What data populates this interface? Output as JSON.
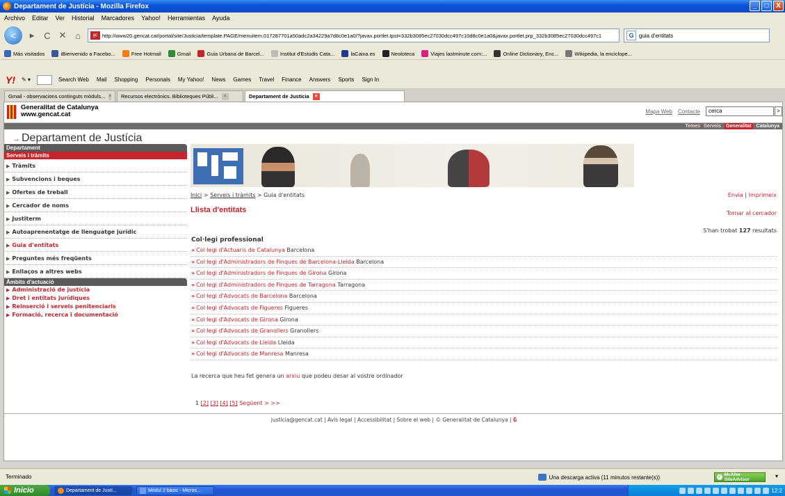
{
  "window": {
    "title": "Departament de Justícia - Mozilla Firefox",
    "min": "_",
    "max": "□",
    "close": "X"
  },
  "menu": [
    "Archivo",
    "Editar",
    "Ver",
    "Historial",
    "Marcadores",
    "Yahoo!",
    "Herramientas",
    "Ayuda"
  ],
  "nav": {
    "back": "<",
    "forward": "▸",
    "reload": "C",
    "stop": "✕",
    "home": "⌂",
    "url": "http://www20.gencat.cat/portal/site/Justicia/template.PAGE/menuitem.017287701a50adc2a34229a7d8c0e1a0/?javax.portlet.tpst=332b3085ec27030dcc497c10d8c0e1a0&javax.portlet.prp_332b3085ec27030dcc497c1",
    "search_value": "guia d'entitats"
  },
  "bookmarks": [
    {
      "label": "Más visitados",
      "color": "#3a66b8"
    },
    {
      "label": "iBienvenido a Facebo...",
      "color": "#3b5998"
    },
    {
      "label": "Free Hotmail",
      "color": "#f07d1a"
    },
    {
      "label": "Gmail",
      "color": "#2e8b3a"
    },
    {
      "label": "Guia Urbana de Barcel...",
      "color": "#c4242c"
    },
    {
      "label": "Institut d'Estudis Cata...",
      "color": "#bbbbbb"
    },
    {
      "label": "laCaixa.es",
      "color": "#1b3b8c"
    },
    {
      "label": "Neoloteca",
      "color": "#222222"
    },
    {
      "label": "Viajes lastminute.com:...",
      "color": "#d6207e"
    },
    {
      "label": "Online Dictionary, Enc...",
      "color": "#333333"
    },
    {
      "label": "Wikipedia, la enciclope...",
      "color": "#777777"
    }
  ],
  "yahoo_toolbar": {
    "logo": "Y!",
    "items": [
      "Search Web",
      "Mail",
      "Shopping",
      "Personals",
      "My Yahoo!",
      "News",
      "Games",
      "Travel",
      "Finance",
      "Answers",
      "Sports",
      "Sign In"
    ]
  },
  "tabs": [
    {
      "label": "Gmail - observacions continguts mòduls...",
      "active": false
    },
    {
      "label": "Recursos electrònics. Biblioteques Públi...",
      "active": false
    },
    {
      "label": "Departament de Justícia",
      "active": true
    }
  ],
  "site": {
    "org_name": "Generalitat de Catalunya",
    "org_url": "www.gencat.cat",
    "top_links": [
      "Mapa Web",
      "Contacte"
    ],
    "search_value": "cerca",
    "search_go": ">",
    "category_nav": [
      "Temes",
      "Serveis",
      "Generalitat",
      "Catalunya"
    ],
    "category_active": "Generalitat",
    "dept_title": "Departament de Justícia",
    "dept_arrow": "→"
  },
  "sidebar": {
    "heading1": "Departament",
    "heading2": "Serveis i tràmits",
    "items": [
      "Tràmits",
      "Subvencions i beques",
      "Ofertes de treball",
      "Cercador de noms",
      "Justiterm",
      "Autoaprenentatge de llenguatge jurídic",
      "Guia d'entitats",
      "Preguntes més freqüents",
      "Enllaços a altres webs"
    ],
    "active_item": "Guia d'entitats",
    "heading3": "Àmbits d'actuació",
    "ambits": [
      "Administració de justícia",
      "Dret i entitats jurídiques",
      "Reinserció i serveis penitenciaris",
      "Formació, recerca i documentació"
    ]
  },
  "breadcrumb": {
    "home": "Inici",
    "sep1": " > ",
    "section": "Serveis i tràmits",
    "sep2": " > ",
    "current": "Guia d'entitats"
  },
  "page_tools": {
    "send": "Envia",
    "sep": " | ",
    "print": "Imprimeix"
  },
  "main": {
    "title": "Llista d'entitats",
    "back_search": "Tornar al cercador",
    "results_prefix": "S'han trobat ",
    "results_count": "127",
    "results_suffix": " resultats",
    "section": "Col·legi professional",
    "entities": [
      {
        "name": "Col·legi d'Actuaris de Catalunya",
        "city": "Barcelona"
      },
      {
        "name": "Col·legi d'Administradors de Finques de Barcelona-Lleida",
        "city": "Barcelona"
      },
      {
        "name": "Col·legi d'Administradors de Finques de Girona",
        "city": "Girona"
      },
      {
        "name": "Col·legi d'Administradors de Finques de Tarragona",
        "city": "Tarragona"
      },
      {
        "name": "Col·legi d'Advocats de Barcelona",
        "city": "Barcelona"
      },
      {
        "name": "Col·legi d'Advocats de Figueres",
        "city": "Figueres"
      },
      {
        "name": "Col·legi d'Advocats de Girona",
        "city": "Girona"
      },
      {
        "name": "Col·legi d'Advocats de Granollers",
        "city": "Granollers"
      },
      {
        "name": "Col·legi d'Advocats de Lleida",
        "city": "Lleida"
      },
      {
        "name": "Col·legi d'Advocats de Manresa",
        "city": "Manresa"
      }
    ],
    "entity_arrow": "»",
    "download_pre": "La recerca que heu fet genera un ",
    "download_link": "arxiu",
    "download_post": " que podeu desar al vostre ordinador",
    "pager": {
      "current": "1",
      "pages": [
        "[2]",
        "[3]",
        "[4]",
        "[5]"
      ],
      "next": "Següent >",
      "last": ">>"
    }
  },
  "footer": "justicia@gencat.cat | Avís legal | Accessibilitat | Sobre el web | © Generalitat de Catalunya |",
  "status": {
    "text": "Terminado",
    "download": "Una descarga activa (11 minutos restante(s))",
    "mcafee": "McAfee SiteAdvisor"
  },
  "taskbar": {
    "start": "Inicio",
    "buttons": [
      {
        "label": "Departament de Justí...",
        "active": true
      },
      {
        "label": "Mòdul 2 bàsic - Micros...",
        "active": false
      }
    ],
    "clock": "12:2"
  }
}
